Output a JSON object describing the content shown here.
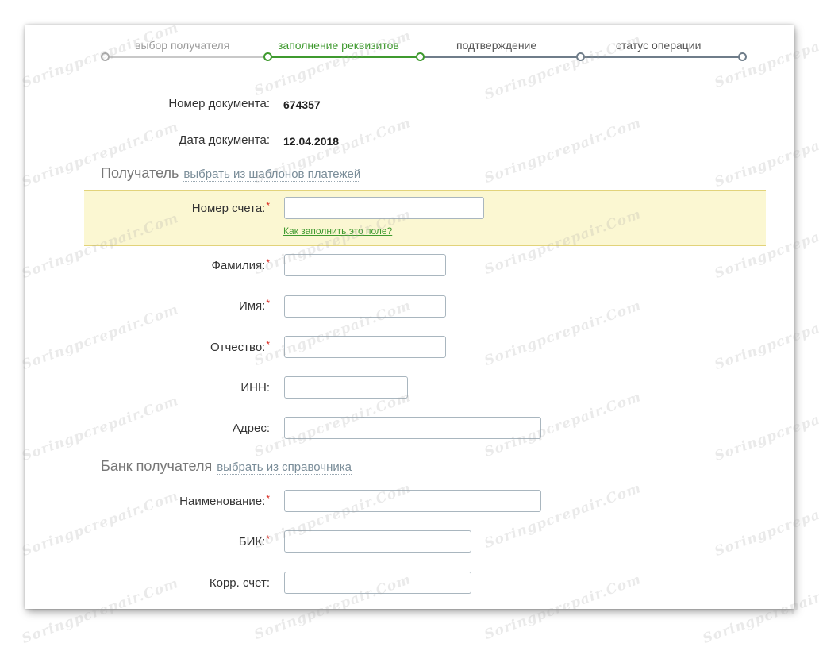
{
  "steps": [
    {
      "label": "выбор получателя",
      "state": "done"
    },
    {
      "label": "заполнение реквизитов",
      "state": "active"
    },
    {
      "label": "подтверждение",
      "state": "pending"
    },
    {
      "label": "статус операции",
      "state": "pending"
    }
  ],
  "document": {
    "number_label": "Номер документа:",
    "number_value": "674357",
    "date_label": "Дата документа:",
    "date_value": "12.04.2018"
  },
  "recipient_section": {
    "title": "Получатель",
    "link": "выбрать из шаблонов платежей",
    "account_label": "Номер счета:",
    "account_help": "Как заполнить это поле?",
    "surname_label": "Фамилия:",
    "name_label": "Имя:",
    "patronymic_label": "Отчество:",
    "inn_label": "ИНН:",
    "address_label": "Адрес:"
  },
  "bank_section": {
    "title": "Банк получателя",
    "link": "выбрать из справочника",
    "name_label": "Наименование:",
    "bik_label": "БИК:",
    "corr_label": "Корр. счет:"
  },
  "required_mark": "*",
  "watermark": "Soringpcrepair.Com",
  "colors": {
    "active_step": "#3f9a2f",
    "highlight_bg": "#fbf7d2",
    "required": "#d9261c"
  }
}
